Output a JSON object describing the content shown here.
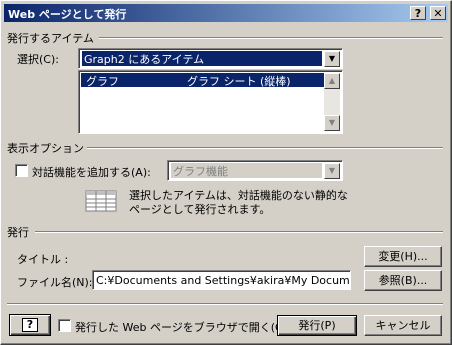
{
  "window": {
    "title": "Web ページとして発行",
    "help_btn": "?",
    "close_btn": "✕"
  },
  "publish_items": {
    "heading": "発行するアイテム",
    "select_label": "選択(C):",
    "selected_value": "Graph2 にあるアイテム",
    "list": [
      {
        "name": "グラフ",
        "type": "グラフ シート (縦棒)"
      }
    ]
  },
  "display_options": {
    "heading": "表示オプション",
    "interactive_label": "対話機能を追加する(A):",
    "interactive_checked": false,
    "interactive_combo_value": "グラフ機能",
    "description": [
      "選択したアイテムは、対話機能のない静的な",
      "ページとして発行されます。"
    ],
    "icon": "table-grid-icon"
  },
  "publish": {
    "heading": "発行",
    "title_label": "タイトル :",
    "change_button": "変更(H)...",
    "filename_label": "ファイル名(N):",
    "filename_value": "C:¥Documents and Settings¥akira¥My Documents",
    "browse_button": "参照(B)..."
  },
  "footer": {
    "help_icon_btn": "?",
    "open_in_browser_label": "発行した Web ページをブラウザで開く(O)",
    "open_in_browser_checked": false,
    "publish_button": "発行(P)",
    "cancel_button": "キャンセル"
  },
  "colors": {
    "title_start": "#0a246a",
    "title_end": "#a6caf0",
    "selection": "#0a246a",
    "face": "#d4d0c8"
  }
}
